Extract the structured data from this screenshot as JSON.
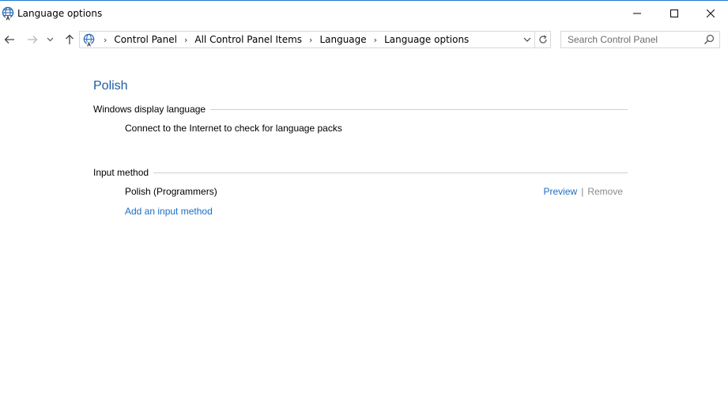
{
  "window": {
    "title": "Language options"
  },
  "navigation": {
    "breadcrumbs": [
      "Control Panel",
      "All Control Panel Items",
      "Language",
      "Language options"
    ],
    "search_placeholder": "Search Control Panel"
  },
  "main": {
    "language_name": "Polish",
    "display_language_section": {
      "heading": "Windows display language",
      "status_text": "Connect to the Internet to check for language packs"
    },
    "input_method_section": {
      "heading": "Input method",
      "methods": [
        {
          "name": "Polish (Programmers)",
          "preview_label": "Preview",
          "separator": "|",
          "remove_label": "Remove"
        }
      ],
      "add_label": "Add an input method"
    }
  },
  "colors": {
    "title_accent": "#1e5aa8",
    "link": "#1a6fc6",
    "disabled": "#8a8a8a"
  },
  "icons": {
    "app": "globe-language-icon",
    "back": "back-arrow-icon",
    "forward": "forward-arrow-icon",
    "recent": "chevron-down-icon",
    "up": "up-arrow-icon",
    "refresh": "refresh-icon",
    "search": "search-icon"
  }
}
